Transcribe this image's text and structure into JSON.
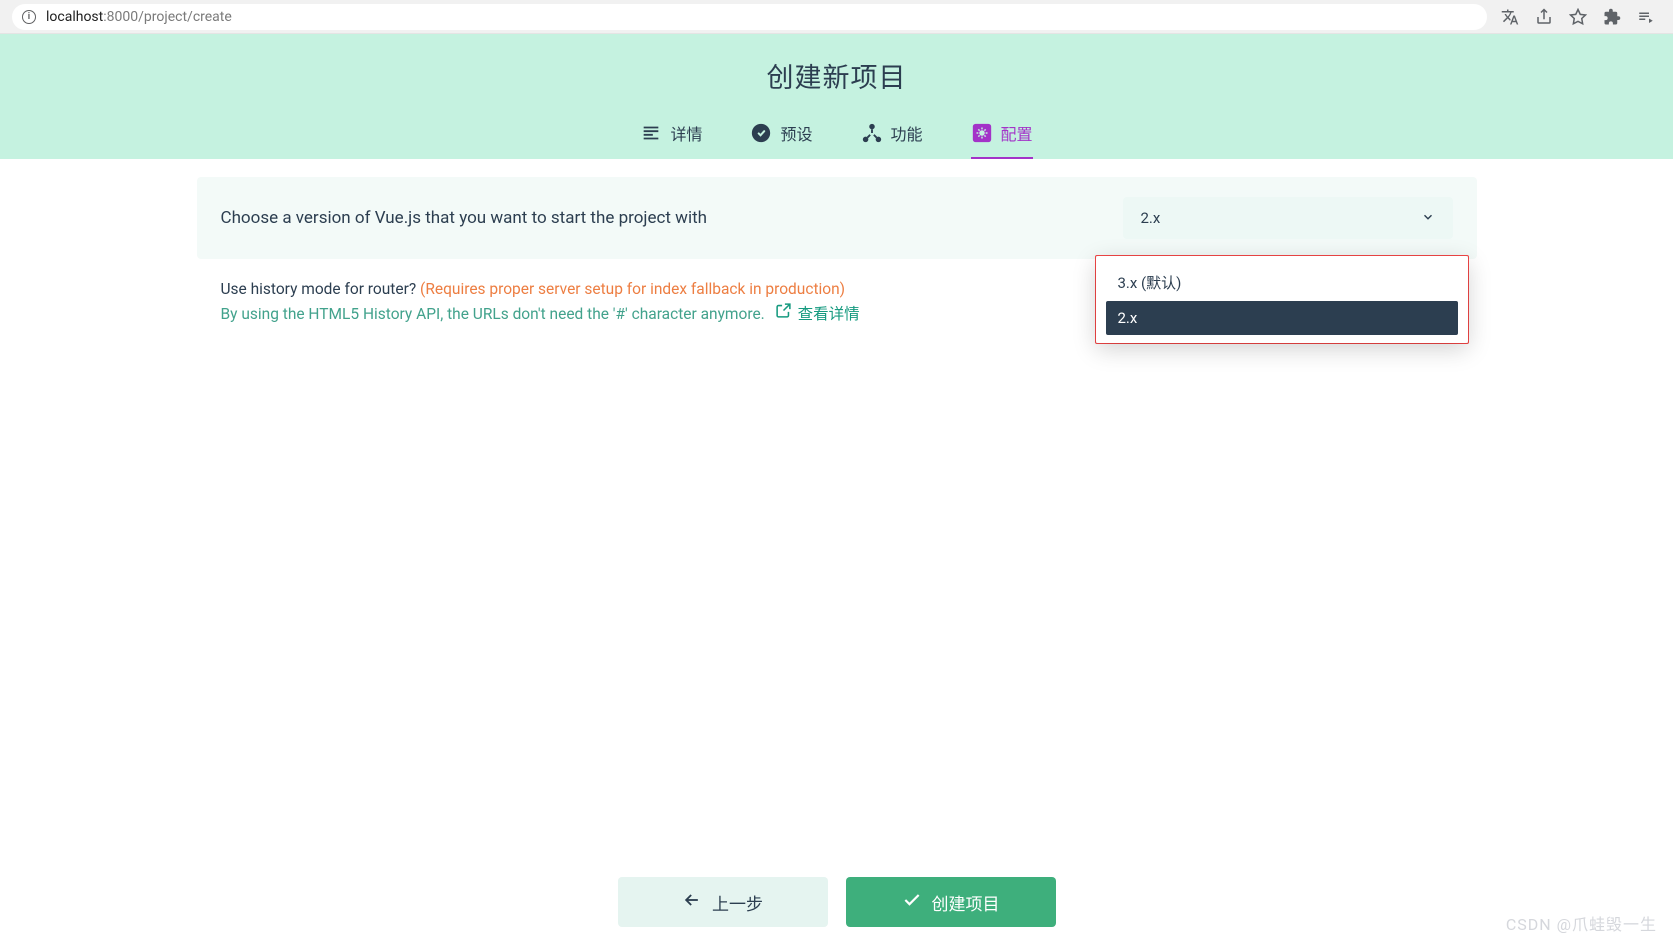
{
  "browser": {
    "url_host": "localhost",
    "url_port": ":8000",
    "url_path": "/project/create"
  },
  "header": {
    "title": "创建新项目",
    "tabs": [
      {
        "label": "详情"
      },
      {
        "label": "预设"
      },
      {
        "label": "功能"
      },
      {
        "label": "配置"
      }
    ]
  },
  "configRow": {
    "label": "Choose a version of Vue.js that you want to start the project with",
    "selectValue": "2.x",
    "options": [
      {
        "label": "3.x (默认)"
      },
      {
        "label": "2.x"
      }
    ]
  },
  "historyRow": {
    "question": "Use history mode for router? ",
    "warning": "(Requires proper server setup for index fallback in production)",
    "description": "By using the HTML5 History API, the URLs don't need the '#' character anymore.",
    "linkLabel": "查看详情"
  },
  "footer": {
    "prev": "上一步",
    "create": "创建项目"
  },
  "watermark": "CSDN @爪蛙毁一生"
}
